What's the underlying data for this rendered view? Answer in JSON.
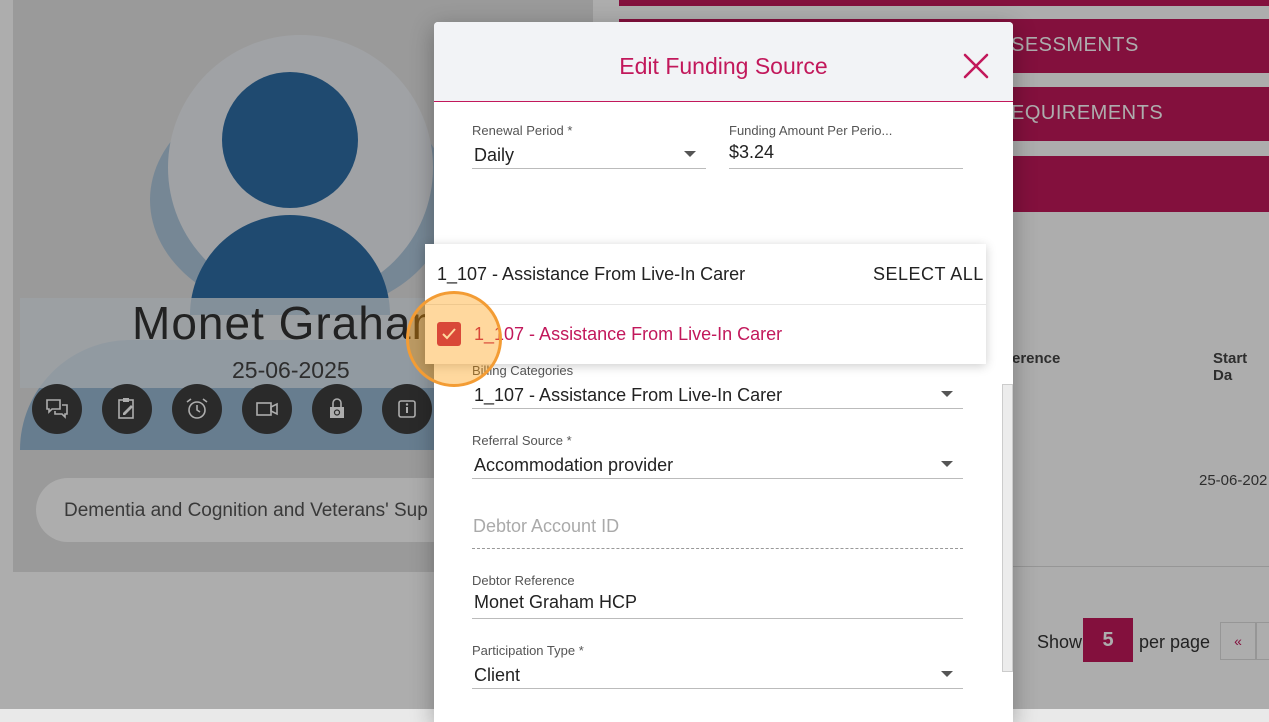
{
  "profile": {
    "name": "Monet Graham",
    "date": "25-06-2025",
    "tags": "Dementia and Cognition and Veterans' Sup"
  },
  "right_panel": {
    "tabs": [
      "SESSMENTS",
      "EQUIREMENTS"
    ],
    "table": {
      "headers": [
        "erence",
        "Start Da"
      ],
      "row": [
        "25-06-202"
      ]
    },
    "pager": {
      "show_label": "Show",
      "page_size": "5",
      "per_page_label": "per page",
      "first_symbol": "«"
    }
  },
  "modal": {
    "title": "Edit Funding Source",
    "fields": {
      "renewal_period": {
        "label": "Renewal Period *",
        "value": "Daily"
      },
      "funding_amount": {
        "label": "Funding Amount Per Perio...",
        "value": "$3.24"
      },
      "billing_categories": {
        "label": "Billing Categories",
        "value": "1_107 - Assistance From Live-In Carer"
      },
      "referral_source": {
        "label": "Referral Source *",
        "value": "Accommodation provider"
      },
      "debtor_account_id": {
        "placeholder": "Debtor Account ID"
      },
      "debtor_reference": {
        "label": "Debtor Reference",
        "value": "Monet Graham HCP"
      },
      "participation_type": {
        "label": "Participation Type *",
        "value": "Client"
      }
    }
  },
  "dropdown": {
    "filter_text": "1_107 - Assistance From Live-In Carer",
    "select_all": "SELECT ALL",
    "options": [
      {
        "label": "1_107 - Assistance From Live-In Carer",
        "checked": true
      }
    ]
  },
  "colors": {
    "accent": "#c2185b",
    "highlight": "#f39c34"
  }
}
